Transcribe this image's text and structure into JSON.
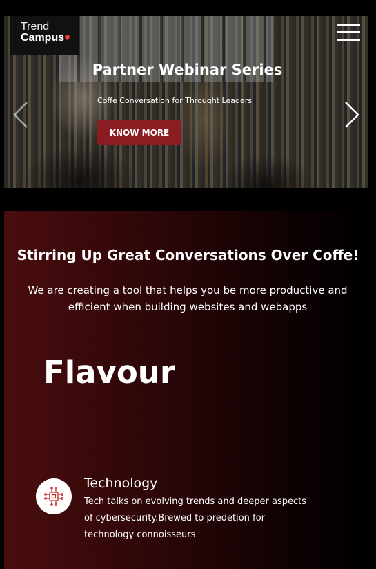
{
  "header": {
    "logo_line1": "Trend",
    "logo_line2": "Campus",
    "menu_icon": "hamburger-menu-icon"
  },
  "hero": {
    "title": "Partner Webinar Series",
    "subtitle": "Coffe Conversation for Throught Leaders",
    "button_label": "KNOW MORE",
    "prev_icon": "chevron-left-icon",
    "next_icon": "chevron-right-icon"
  },
  "section": {
    "title": "Stirring Up Great Conversations Over Coffe!",
    "description": "We are creating a tool that helps you be more productive and efficient when building websites and webapps",
    "heading": "Flavour",
    "feature": {
      "icon": "circuit-chip-icon",
      "title": "Technology",
      "description": "Tech talks on evolving trends and deeper aspects of cybersecurity.Brewed to predetion for technology connoisseurs"
    }
  },
  "colors": {
    "accent": "#8b1d22",
    "pin": "#e53935",
    "icon_red": "#c62828"
  }
}
